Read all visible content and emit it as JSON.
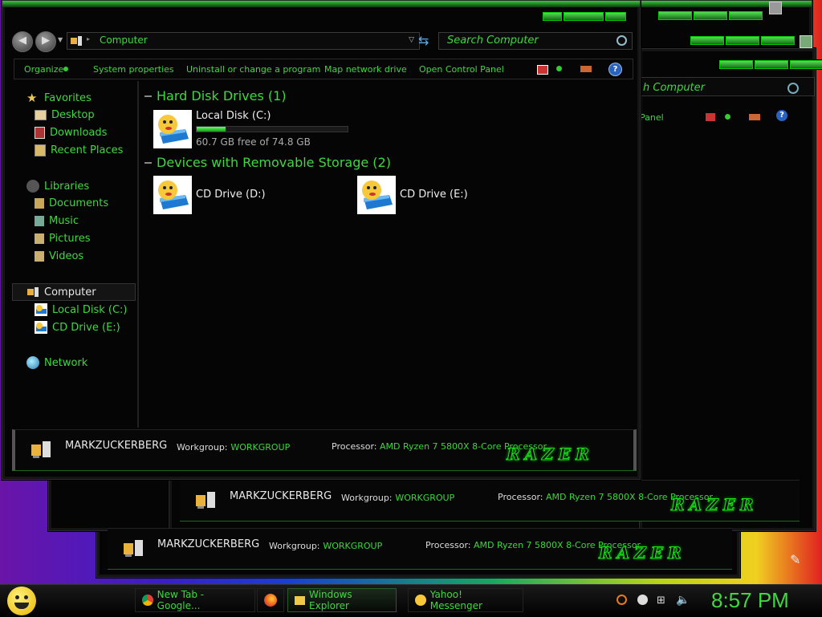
{
  "address": {
    "location": "Computer"
  },
  "search": {
    "placeholder": "Search Computer"
  },
  "toolbar": {
    "organize": "Organize",
    "system_properties": "System properties",
    "uninstall": "Uninstall or change a program",
    "map_drive": "Map network drive",
    "control_panel": "Open Control Panel"
  },
  "sidebar": {
    "favorites": "Favorites",
    "desktop": "Desktop",
    "downloads": "Downloads",
    "recent": "Recent Places",
    "libraries": "Libraries",
    "documents": "Documents",
    "music": "Music",
    "pictures": "Pictures",
    "videos": "Videos",
    "computer": "Computer",
    "local_disk": "Local Disk (C:)",
    "cd_drive": "CD Drive (E:)",
    "network": "Network"
  },
  "main": {
    "hdd_header": "Hard Disk Drives (1)",
    "local_disk_name": "Local Disk (C:)",
    "local_disk_free": "60.7 GB free of 74.8 GB",
    "local_disk_used_fraction": 0.19,
    "removable_header": "Devices with Removable Storage (2)",
    "cd_d": "CD Drive (D:)",
    "cd_e": "CD Drive (E:)"
  },
  "details": {
    "computer_name": "MARKZUCKERBERG",
    "workgroup_label": "Workgroup:",
    "workgroup": "WORKGROUP",
    "processor_label": "Processor:",
    "processor": "AMD Ryzen 7 5800X 8-Core Processor",
    "brand": "RAZER"
  },
  "background_window": {
    "search": "h Computer",
    "toolbar_fragment": "Panel"
  },
  "taskbar": {
    "chrome": "New Tab - Google...",
    "explorer": "Windows Explorer",
    "yahoo": "Yahoo! Messenger",
    "clock": "8:57 PM"
  },
  "colors": {
    "accent": "#3fd83f",
    "window_bg": "#050505"
  }
}
